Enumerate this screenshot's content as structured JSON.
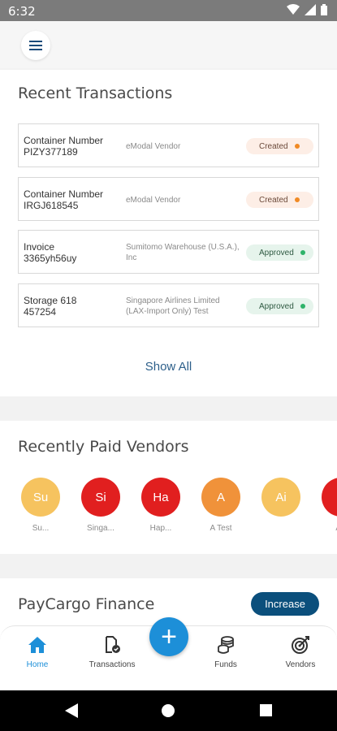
{
  "status_bar": {
    "time": "6:32"
  },
  "header": {
    "menu_icon": "hamburger-menu-icon"
  },
  "recent_transactions": {
    "title": "Recent Transactions",
    "items": [
      {
        "label1": "Container Number",
        "label2": "PIZY377189",
        "vendor": "eModal Vendor",
        "status": "Created",
        "status_color": "#f08a24"
      },
      {
        "label1": "Container Number",
        "label2": "IRGJ618545",
        "vendor": "eModal Vendor",
        "status": "Created",
        "status_color": "#f08a24"
      },
      {
        "label1": "Invoice",
        "label2": "3365yh56uy",
        "vendor": "Sumitomo Warehouse (U.S.A.), Inc",
        "status": "Approved",
        "status_color": "#2fb36a"
      },
      {
        "label1": "Storage 618",
        "label2": "457254",
        "vendor": "Singapore Airlines Limited (LAX-Import Only) Test",
        "status": "Approved",
        "status_color": "#2fb36a"
      }
    ],
    "show_all": "Show All"
  },
  "recently_paid_vendors": {
    "title": "Recently Paid Vendors",
    "vendors": [
      {
        "initials": "Su",
        "name": "Su...",
        "color": "#f6c35f"
      },
      {
        "initials": "Si",
        "name": "Singa...",
        "color": "#e11f1f"
      },
      {
        "initials": "Ha",
        "name": "Hap...",
        "color": "#e11f1f"
      },
      {
        "initials": "A",
        "name": "A Test",
        "color": "#f0923a"
      },
      {
        "initials": "Ai",
        "name": "",
        "color": "#f6c35f"
      },
      {
        "initials": "A",
        "name": "Alli",
        "color": "#e11f1f"
      }
    ]
  },
  "finance": {
    "title": "PayCargo Finance",
    "increase_label": "Increase"
  },
  "bottom_nav": {
    "items": [
      {
        "label": "Home",
        "icon": "home-icon",
        "active": true
      },
      {
        "label": "Transactions",
        "icon": "transactions-icon"
      },
      {
        "label": "Funds",
        "icon": "funds-icon"
      },
      {
        "label": "Vendors",
        "icon": "vendors-icon"
      }
    ],
    "fab_label": "+"
  },
  "colors": {
    "accent": "#1d8fd8",
    "primary_dark": "#0b4f7c",
    "link": "#2d5f8a"
  }
}
